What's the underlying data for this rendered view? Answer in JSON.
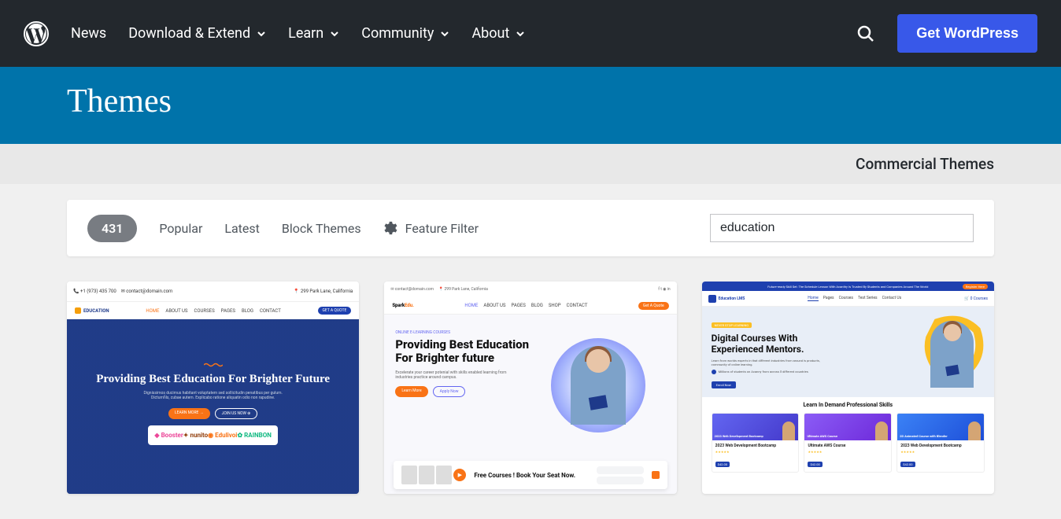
{
  "nav": {
    "news": "News",
    "download": "Download & Extend",
    "learn": "Learn",
    "community": "Community",
    "about": "About",
    "get_wp": "Get WordPress"
  },
  "page": {
    "title": "Themes",
    "commercial": "Commercial Themes"
  },
  "filter": {
    "count": "431",
    "popular": "Popular",
    "latest": "Latest",
    "block": "Block Themes",
    "feature": "Feature Filter",
    "search_value": "education"
  },
  "themes": [
    {
      "logo": "EDUCATION",
      "menu": [
        "HOME",
        "ABOUT US",
        "COURSES",
        "PAGES",
        "BLOG",
        "CONTACT"
      ],
      "cta": "GET A QUOTE",
      "hero_title": "Providing Best Education For Brighter Future",
      "hero_text": "Dignissimos ducimus habitant voluptatem sed sollicitudin penatibus per gulum. Dictumfils, cubae autem. Explicabo ratione aliquatin odio non rapudine.",
      "btn1": "LEARN MORE →",
      "btn2": "JOIN US NOW ⊕",
      "brands": [
        "Booster",
        "nunito",
        "Edulivoi",
        "RAINBON"
      ]
    },
    {
      "logo_a": "Spark",
      "logo_b": "Edu.",
      "menu": [
        "HOME",
        "ABOUT US",
        "PAGES",
        "BLOG",
        "SHOP",
        "CONTACT"
      ],
      "cta": "Get A Quote",
      "tag": "ONLINE E-LEARNING COURSES",
      "hero_title": "Providing Best Education For Brighter future",
      "hero_text": "Excelerate your career potenial with skills enabled learning from industries practice around campus.",
      "btn1": "Learn More",
      "btn2": "Apply Now",
      "free": "Free Courses ! Book Your Seat Now."
    },
    {
      "top_banner": "Future-ready Skill Set: The Schedule Lesson With Acanthy Is Trusted By Students and Companies Around The World",
      "top_btn": "Register Here",
      "logo": "Education LMS",
      "menu": [
        "Home",
        "Pages",
        "Courses",
        "Test Series",
        "Contact Us"
      ],
      "cart": "0 Courses",
      "tag": "NEVER STOP LEARNING",
      "hero_title": "Digital Courses With Experienced Mentors.",
      "hero_text": "Learn from worlds experts in that different industries from around is products, community of online learning.",
      "check": "Millions of students on Acanny from across 5 different countries",
      "btn1": "Enroll Now",
      "section_title": "Learn In Demand Professional Skills",
      "cards": [
        {
          "img_txt": "2023 Web Development Bootcamp",
          "title": "2023 Web Development Bootcamp",
          "price": "$42.00"
        },
        {
          "img_txt": "Ultimate AWS Course",
          "title": "Ultimate AWS Course",
          "price": "$42.00"
        },
        {
          "img_txt": "2D Animated Course with Blender",
          "title": "2023 Web Development Bootcamp",
          "price": "$42.00"
        }
      ]
    }
  ]
}
